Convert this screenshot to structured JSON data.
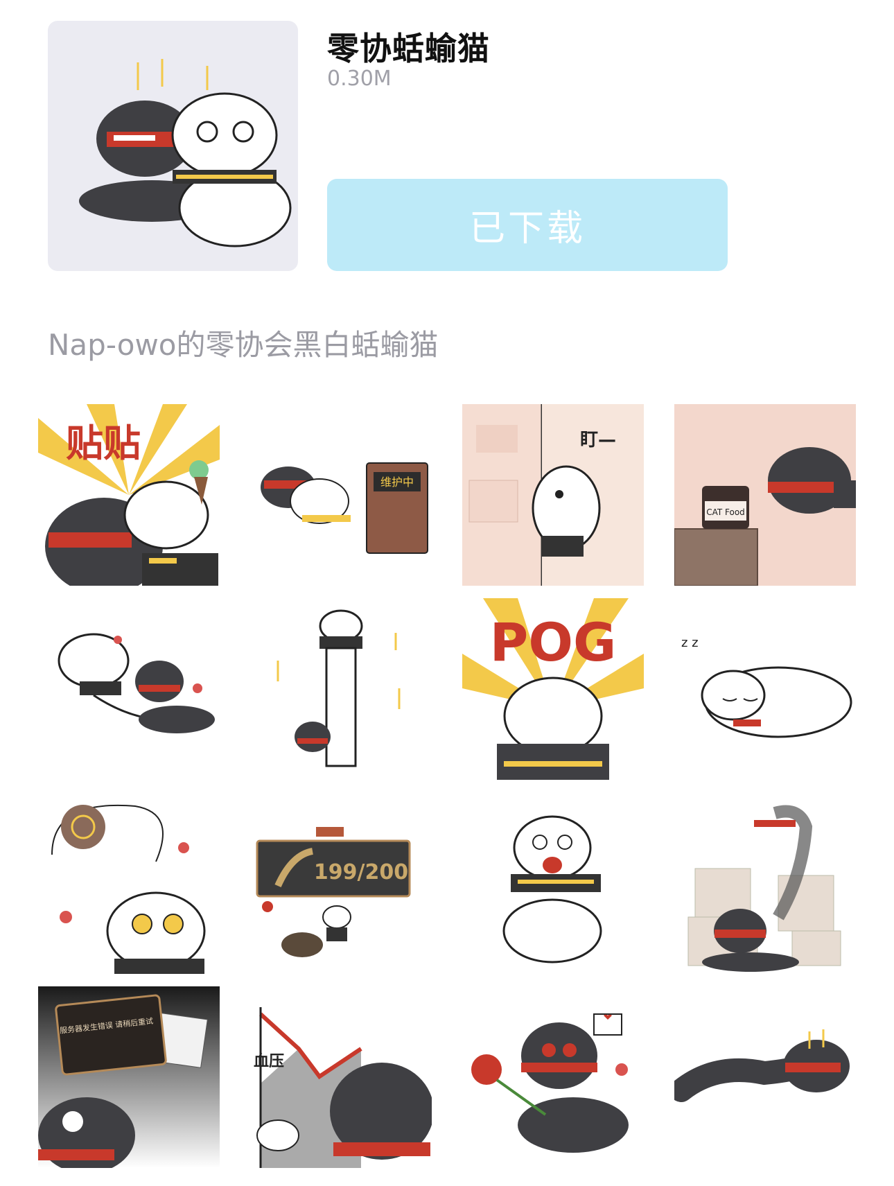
{
  "pack": {
    "title": "零协蛞蝓猫",
    "size": "0.30M",
    "download_label": "已下载",
    "description": "Nap-owo的零协会黑白蛞蝓猫"
  },
  "stickers": [
    {
      "name": "sticker-tiepai",
      "text": "贴贴"
    },
    {
      "name": "sticker-maintenance",
      "text": "维护中"
    },
    {
      "name": "sticker-stare",
      "text": "盯—"
    },
    {
      "name": "sticker-cat-food",
      "text": "CAT Food"
    },
    {
      "name": "sticker-kick",
      "text": ""
    },
    {
      "name": "sticker-long-cat",
      "text": ""
    },
    {
      "name": "sticker-pog",
      "text": "POG"
    },
    {
      "name": "sticker-sleep",
      "text": "z z"
    },
    {
      "name": "sticker-cookie",
      "text": ""
    },
    {
      "name": "sticker-199-200",
      "text": "199/200"
    },
    {
      "name": "sticker-shock",
      "text": ""
    },
    {
      "name": "sticker-ghost",
      "text": ""
    },
    {
      "name": "sticker-server-error",
      "text": "服务器发生错误 请稍后重试"
    },
    {
      "name": "sticker-blood-pressure",
      "text": "血压"
    },
    {
      "name": "sticker-rose",
      "text": ""
    },
    {
      "name": "sticker-crawl",
      "text": ""
    }
  ],
  "colors": {
    "button_bg": "#bdeaf8",
    "cover_bg": "#ebebf2",
    "accent_red": "#c8392b",
    "accent_yellow": "#f3c94a",
    "cat_dark": "#3f3f43"
  }
}
